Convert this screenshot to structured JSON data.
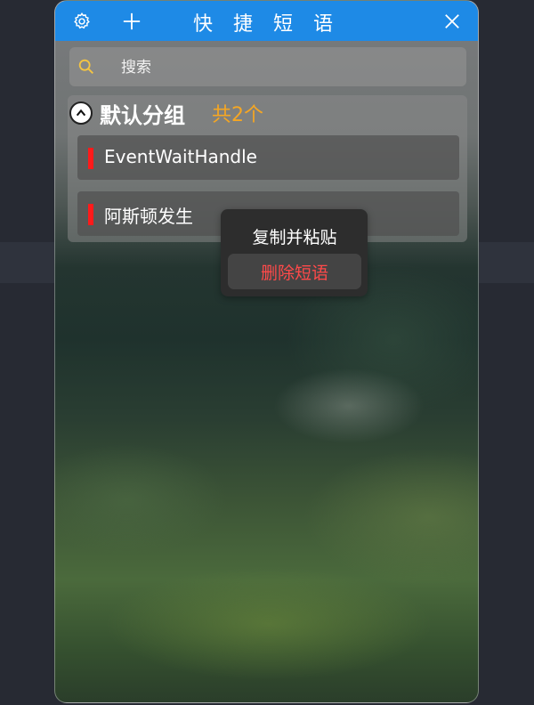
{
  "titlebar": {
    "title": "快 捷 短 语",
    "settings_icon": "gear-icon",
    "add_icon": "plus-icon",
    "close_icon": "close-icon",
    "background_color": "#1e8ae6"
  },
  "search": {
    "placeholder": "搜索",
    "value": "",
    "icon": "search-icon",
    "icon_color": "#f5c542"
  },
  "group": {
    "name": "默认分组",
    "count_label": "共2个",
    "count_color": "#f5a623",
    "collapse_icon": "chevron-up-icon",
    "items": [
      {
        "label": "EventWaitHandle",
        "marker_color": "#ff1a1a"
      },
      {
        "label": "阿斯顿发生",
        "marker_color": "#ff1a1a"
      }
    ]
  },
  "context_menu": {
    "items": [
      {
        "label": "复制并粘贴",
        "color": "#ffffff"
      },
      {
        "label": "删除短语",
        "color": "#ff4a4a",
        "highlighted": true
      }
    ]
  }
}
